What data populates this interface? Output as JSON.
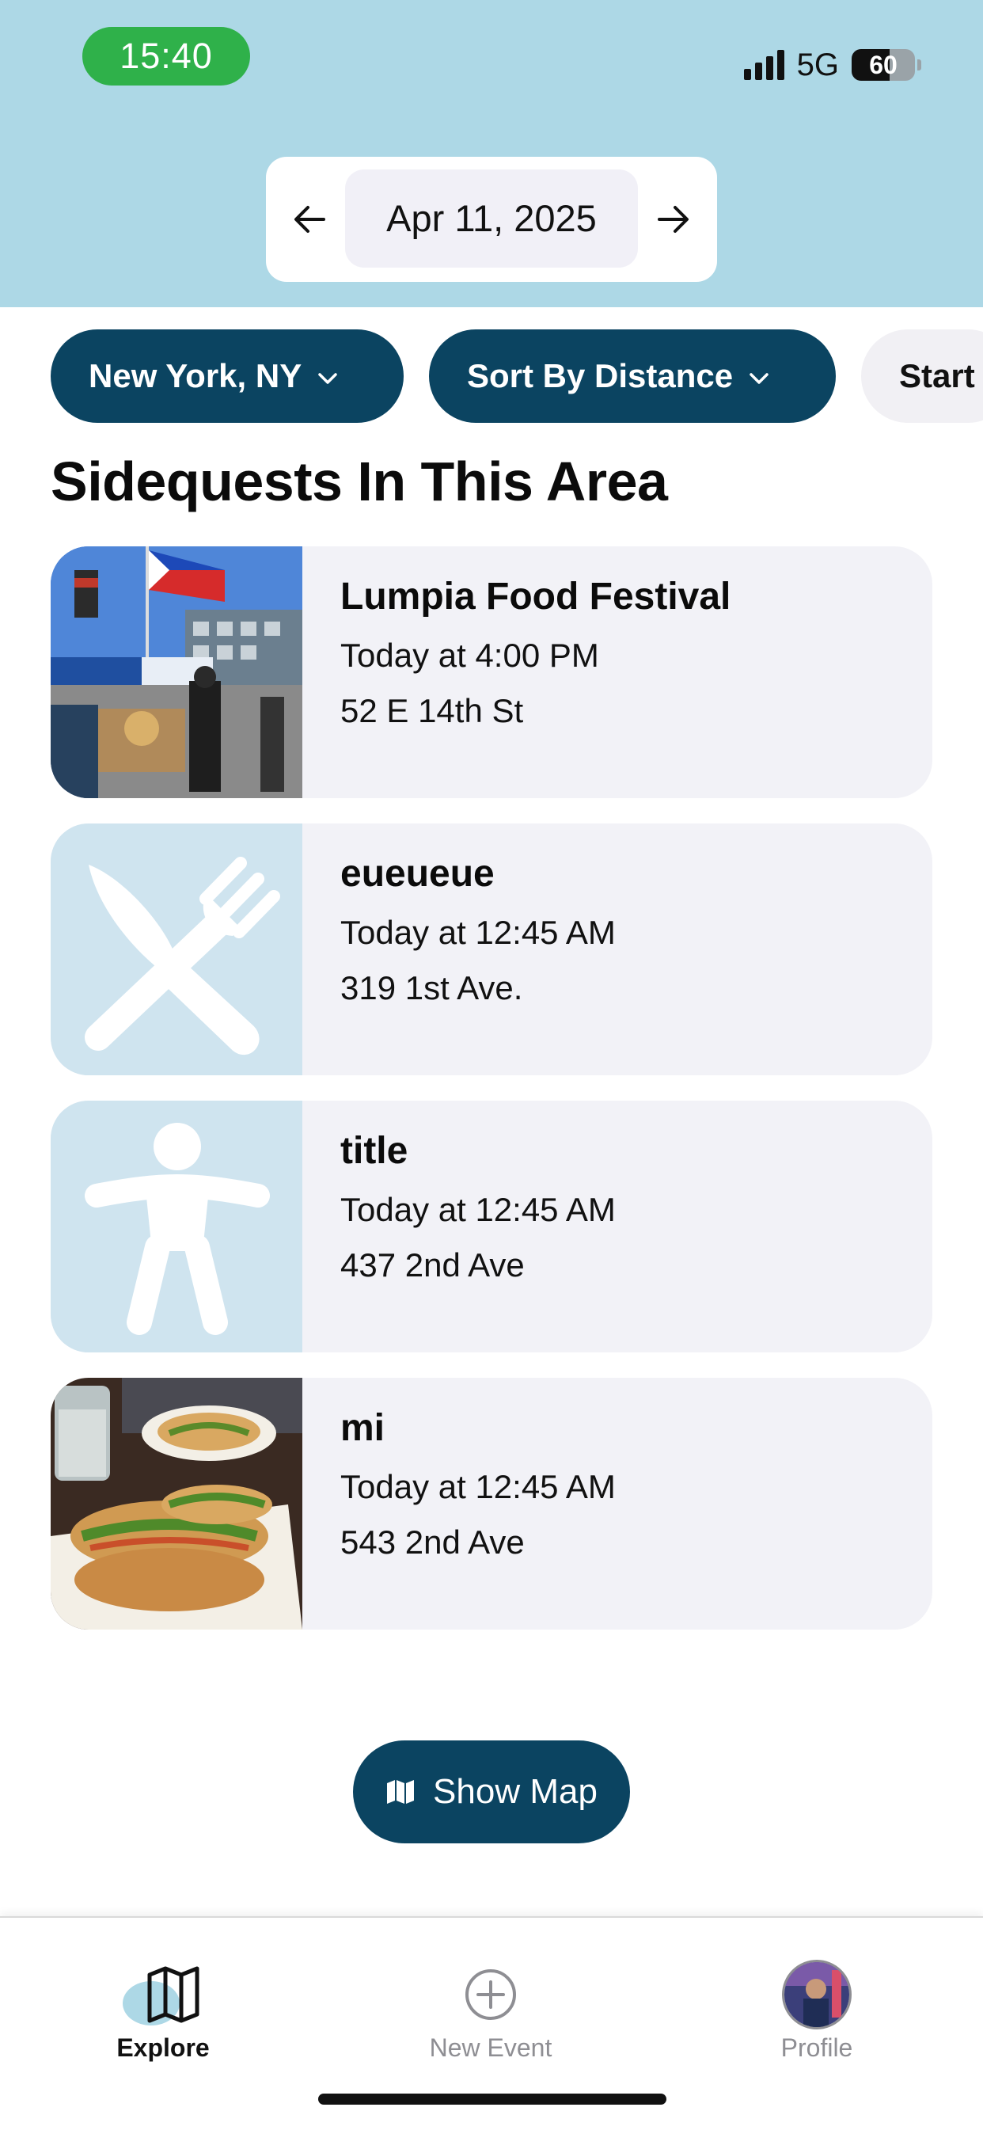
{
  "status_bar": {
    "time": "15:40",
    "network": "5G",
    "battery_percent": 60,
    "battery_label": "60"
  },
  "date_nav": {
    "date": "Apr 11, 2025",
    "prev_label": "←",
    "next_label": "→"
  },
  "filters": {
    "location": "New York, NY",
    "sort": "Sort By Distance",
    "third": "Start"
  },
  "section_title": "Sidequests In This Area",
  "events": [
    {
      "title": "Lumpia Food Festival",
      "time": "Today at 4:00 PM",
      "address": "52 E 14th St",
      "thumb": "photo-festival"
    },
    {
      "title": "eueueue",
      "time": "Today at 12:45 AM",
      "address": "319 1st Ave.",
      "thumb": "fork-knife-icon"
    },
    {
      "title": "title",
      "time": "Today at 12:45 AM",
      "address": "437 2nd Ave",
      "thumb": "person-icon"
    },
    {
      "title": "mi",
      "time": "Today at 12:45 AM",
      "address": "543 2nd Ave",
      "thumb": "photo-sandwich"
    }
  ],
  "show_map_label": "Show Map",
  "tabs": {
    "explore": "Explore",
    "new_event": "New Event",
    "profile": "Profile"
  },
  "colors": {
    "header_bg": "#add8e6",
    "primary": "#0b4461",
    "card_bg": "#f2f2f7",
    "icon_tile_bg": "#cfe4ef",
    "time_pill": "#2fb14a"
  }
}
